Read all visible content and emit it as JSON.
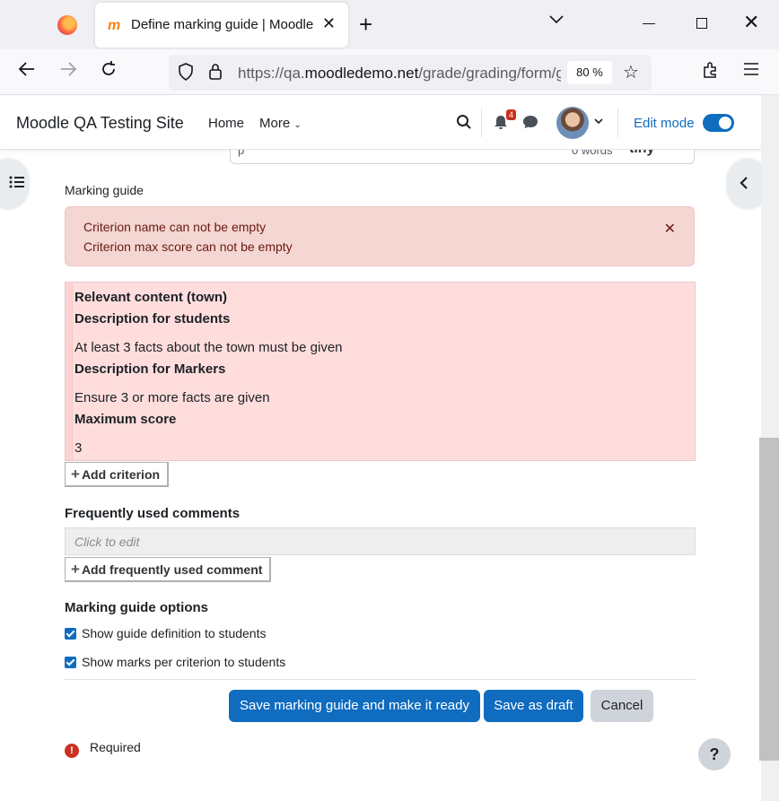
{
  "browser": {
    "tab_title": "Define marking guide | Moodle",
    "url_prefix": "https://qa.",
    "url_domain": "moodledemo.net",
    "url_path": "/grade/grading/form/guide/edit.php",
    "zoom": "80 %"
  },
  "header": {
    "site_name": "Moodle QA Testing Site",
    "nav_home": "Home",
    "nav_more": "More",
    "notification_count": "4",
    "edit_mode_label": "Edit mode",
    "edit_mode_on": true
  },
  "editor": {
    "path": "p",
    "word_count": "0 words",
    "brand": "tiny"
  },
  "form": {
    "section_label": "Marking guide",
    "errors": [
      "Criterion name can not be empty",
      "Criterion max score can not be empty"
    ],
    "criterion": {
      "name": "Relevant content (town)",
      "desc_students_label": "Description for students",
      "desc_students": "At least 3 facts about the town must be given",
      "desc_markers_label": "Description for Markers",
      "desc_markers": "Ensure 3 or more facts are given",
      "max_score_label": "Maximum score",
      "max_score": "3"
    },
    "add_criterion": "Add criterion",
    "comments_heading": "Frequently used comments",
    "comments_placeholder": "Click to edit",
    "add_comment": "Add frequently used comment",
    "options_heading": "Marking guide options",
    "option_show_definition": "Show guide definition to students",
    "option_show_marks": "Show marks per criterion to students",
    "btn_save_ready": "Save marking guide and make it ready",
    "btn_save_draft": "Save as draft",
    "btn_cancel": "Cancel",
    "required_label": "Required",
    "help": "?"
  },
  "colors": {
    "primary": "#0f6cbf",
    "error_bg": "#f4d6d2",
    "criterion_bg": "#ffdddd",
    "danger": "#ca3120"
  }
}
